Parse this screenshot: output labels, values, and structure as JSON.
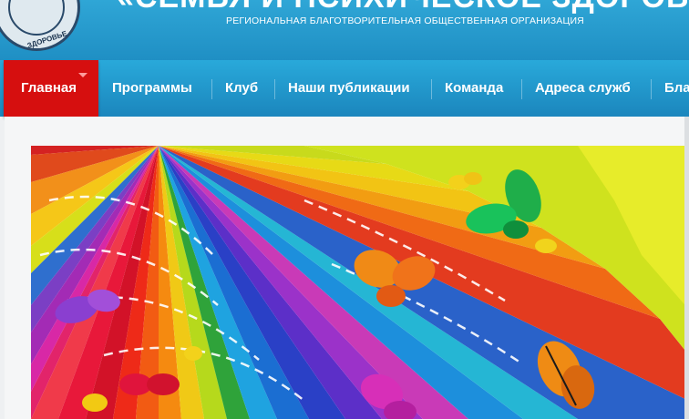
{
  "header": {
    "title": "«СЕМЬЯ И ПСИХИЧЕСКОЕ ЗДОРОВЬЕ»",
    "subtitle": "РЕГИОНАЛЬНАЯ БЛАГОТВОРИТЕЛЬНАЯ ОБЩЕСТВЕННАЯ ОРГАНИЗАЦИЯ",
    "logo_text": "ЗДОРОВЬЕ"
  },
  "nav": {
    "items": [
      {
        "label": "Главная"
      },
      {
        "label": "Программы"
      },
      {
        "label": "Клуб"
      },
      {
        "label": "Наши публикации"
      },
      {
        "label": "Команда"
      },
      {
        "label": "Адреса служб"
      },
      {
        "label": "Бла"
      }
    ]
  },
  "colors": {
    "header": "#2fa6d6",
    "nav": "#1f8fc4",
    "active": "#d60f0f"
  },
  "slider": {
    "image": "fan-of-colour-swatches-with-butterflies"
  }
}
